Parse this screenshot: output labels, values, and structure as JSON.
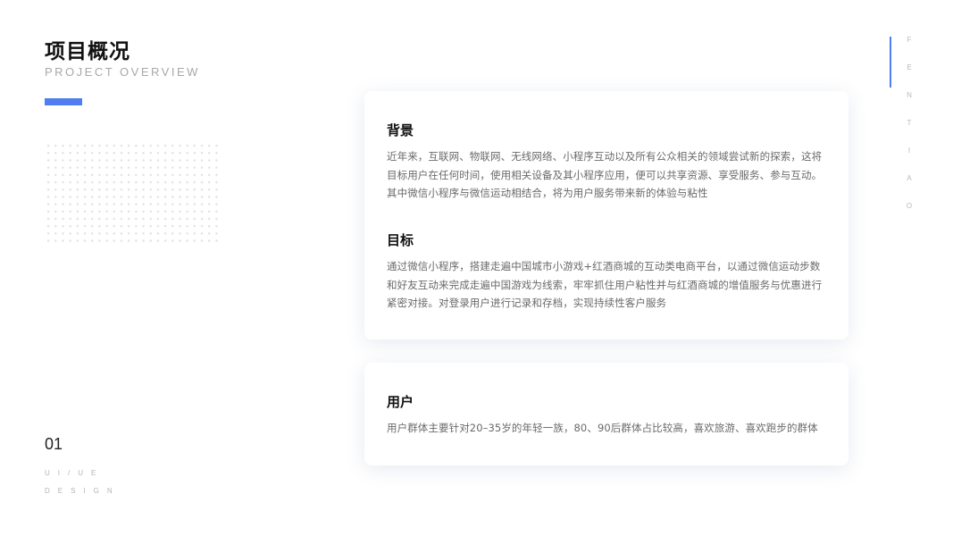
{
  "header": {
    "title_cn": "项目概况",
    "title_en": "PROJECT OVERVIEW"
  },
  "sidebar": {
    "page_number": "01",
    "tag_line1": "UI/UE",
    "tag_line2": "DESIGN",
    "vertical_letters": [
      "F",
      "E",
      "N",
      "T",
      "I",
      "A",
      "O"
    ]
  },
  "colors": {
    "accent": "#4f7ef0",
    "background": "#ffffff"
  },
  "cards": [
    {
      "sections": [
        {
          "heading": "背景",
          "body": "近年来，互联网、物联网、无线网络、小程序互动以及所有公众相关的领域尝试新的探索，这将目标用户在任何时间，使用相关设备及其小程序应用，便可以共享资源、享受服务、参与互动。其中微信小程序与微信运动相结合，将为用户服务带来新的体验与粘性"
        },
        {
          "heading": "目标",
          "body": "通过微信小程序，搭建走遍中国城市小游戏+红酒商城的互动类电商平台，以通过微信运动步数和好友互动来完成走遍中国游戏为线索，牢牢抓住用户粘性并与红酒商城的增值服务与优惠进行紧密对接。对登录用户进行记录和存档，实现持续性客户服务"
        }
      ]
    },
    {
      "sections": [
        {
          "heading": "用户",
          "body": "用户群体主要针对20–35岁的年轻一族，80、90后群体占比较高，喜欢旅游、喜欢跑步的群体"
        }
      ]
    }
  ]
}
